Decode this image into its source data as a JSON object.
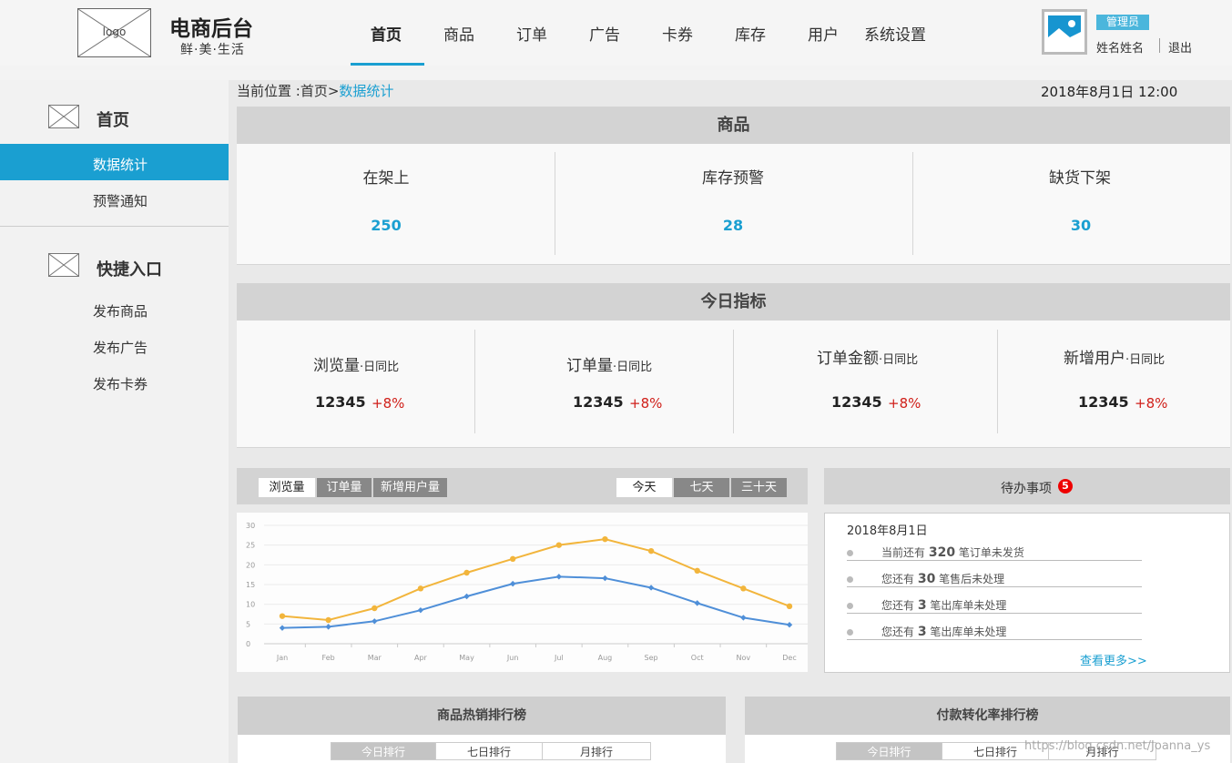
{
  "header": {
    "logo_text": "logo",
    "brand_title": "电商后台",
    "brand_subtitle": "鲜·美·生活",
    "nav": [
      "首页",
      "商品",
      "订单",
      "广告",
      "卡券",
      "库存",
      "用户",
      "系统设置"
    ],
    "active_nav": "首页",
    "role_badge": "管理员",
    "user_name": "姓名姓名",
    "logout": "退出"
  },
  "sidebar": {
    "sections": [
      {
        "title": "首页",
        "items": [
          "数据统计",
          "预警通知"
        ]
      },
      {
        "title": "快捷入口",
        "items": [
          "发布商品",
          "发布广告",
          "发布卡券"
        ]
      }
    ],
    "active_item": "数据统计"
  },
  "breadcrumb": {
    "prefix": "当前位置 :",
    "home": "首页",
    "sep": ">",
    "current": "数据统计"
  },
  "datetime": "2018年8月1日 12:00",
  "goods": {
    "title": "商品",
    "stats": [
      {
        "label": "在架上",
        "value": "250"
      },
      {
        "label": "库存预警",
        "value": "28"
      },
      {
        "label": "缺货下架",
        "value": "30"
      }
    ]
  },
  "today": {
    "title": "今日指标",
    "sub": "·日同比",
    "metrics": [
      {
        "label": "浏览量",
        "value": "12345",
        "change": "+8%"
      },
      {
        "label": "订单量",
        "value": "12345",
        "change": "+8%"
      },
      {
        "label": "订单金额",
        "value": "12345",
        "change": "+8%"
      },
      {
        "label": "新增用户",
        "value": "12345",
        "change": "+8%"
      }
    ]
  },
  "chart_tabs": {
    "metric": [
      "浏览量",
      "订单量",
      "新增用户量"
    ],
    "range": [
      "今天",
      "七天",
      "三十天"
    ]
  },
  "chart_data": {
    "type": "line",
    "categories": [
      "Jan",
      "Feb",
      "Mar",
      "Apr",
      "May",
      "Jun",
      "Jul",
      "Aug",
      "Sep",
      "Oct",
      "Nov",
      "Dec"
    ],
    "series": [
      {
        "values": [
          7,
          6,
          9,
          14,
          18,
          21.5,
          25,
          26.5,
          23.5,
          18.5,
          14,
          9.5
        ],
        "color": "#f2b53c"
      },
      {
        "values": [
          4,
          4.3,
          5.7,
          8.5,
          12,
          15.2,
          17,
          16.6,
          14.2,
          10.3,
          6.6,
          4.8
        ],
        "color": "#4f8fd8"
      }
    ],
    "yticks": [
      "0",
      "5",
      "10",
      "15",
      "20",
      "25",
      "30"
    ],
    "ylim": [
      0,
      30
    ],
    "grid": true
  },
  "todo": {
    "title": "待办事项",
    "badge": "5",
    "date": "2018年8月1日",
    "items": [
      {
        "pre": "当前还有",
        "num": "320",
        "post": "笔订单未发货"
      },
      {
        "pre": "您还有",
        "num": "30",
        "post": "笔售后未处理"
      },
      {
        "pre": "您还有",
        "num": "3",
        "post": "笔出库单未处理"
      },
      {
        "pre": "您还有",
        "num": "3",
        "post": "笔出库单未处理"
      }
    ],
    "more": "查看更多>>"
  },
  "rank_panels": [
    {
      "title": "商品热销排行榜",
      "tabs": [
        "今日排行",
        "七日排行",
        "月排行"
      ]
    },
    {
      "title": "付款转化率排行榜",
      "tabs": [
        "今日排行",
        "七日排行",
        "月排行"
      ]
    }
  ],
  "watermark": "https://blog.csdn.net/Joanna_ys",
  "colors": {
    "accent": "#1a9fd1",
    "up": "#d0201a",
    "orange_series": "#f2b53c",
    "blue_series": "#4f8fd8"
  }
}
